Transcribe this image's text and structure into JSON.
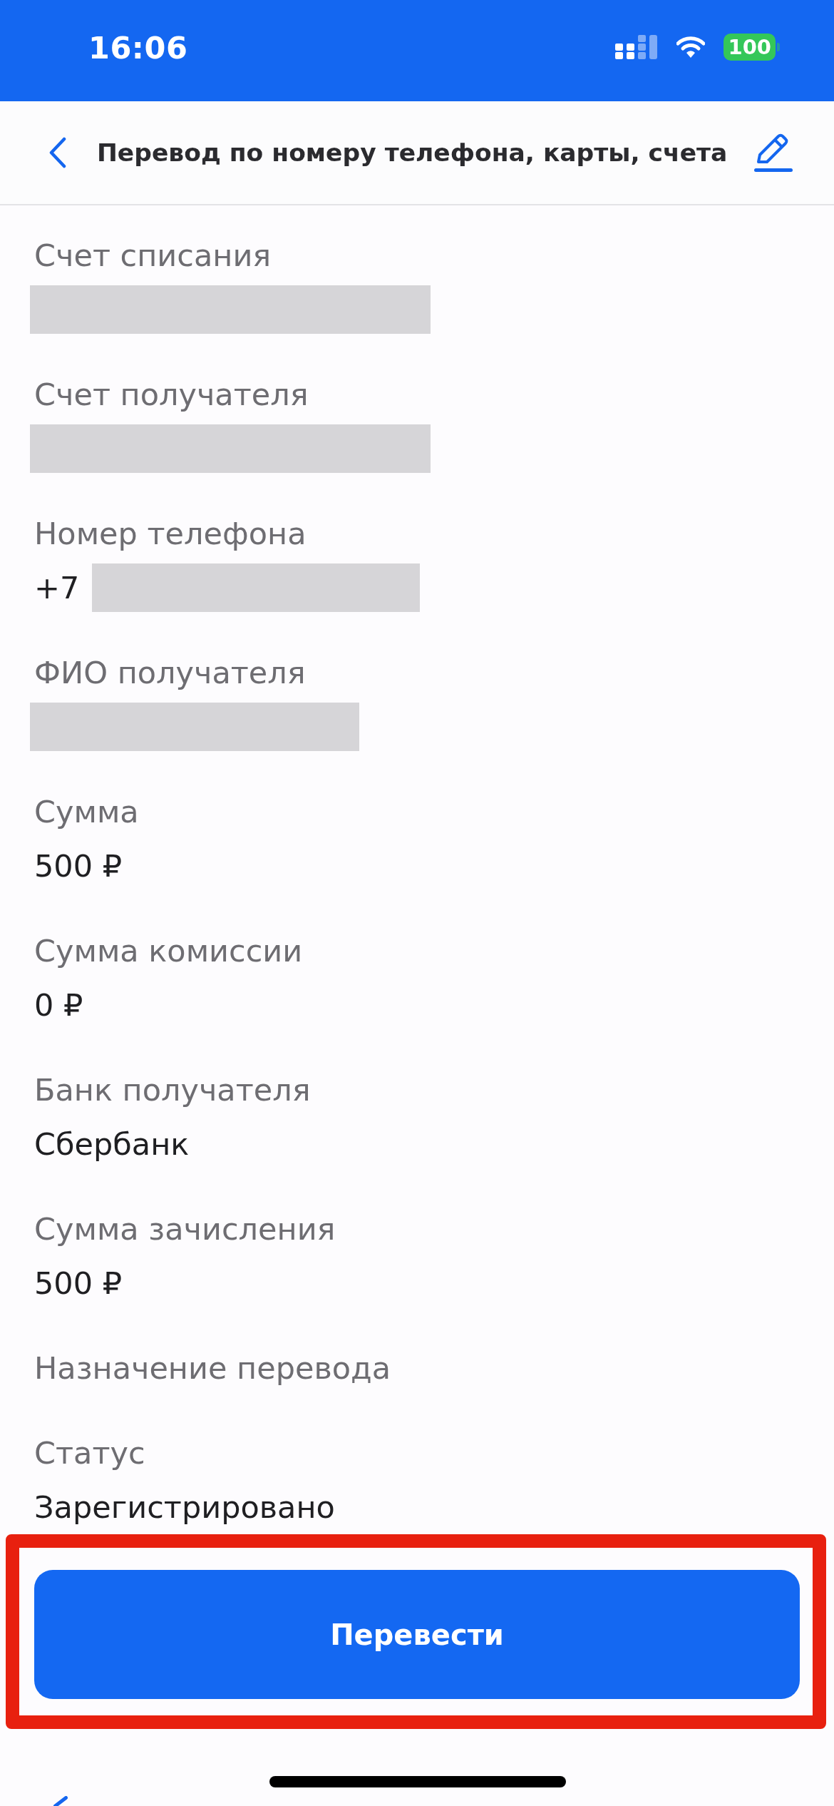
{
  "status_bar": {
    "time": "16:06",
    "battery": "100"
  },
  "header": {
    "title": "Перевод по номеру телефона, карты, счета"
  },
  "fields": [
    {
      "label": "Счет списания",
      "redacted": true
    },
    {
      "label": "Счет получателя",
      "redacted": true
    },
    {
      "label": "Номер телефона",
      "value": "+7",
      "redacted": true
    },
    {
      "label": "ФИО получателя",
      "redacted": true
    },
    {
      "label": "Сумма",
      "value": "500 ₽"
    },
    {
      "label": "Сумма комиссии",
      "value": "0 ₽"
    },
    {
      "label": "Банк получателя",
      "value": "Сбербанк"
    },
    {
      "label": "Сумма зачисления",
      "value": "500 ₽"
    },
    {
      "label": "Назначение перевода"
    },
    {
      "label": "Статус",
      "value": "Зарегистрировано"
    }
  ],
  "button": {
    "label": "Перевести",
    "highlighted": true
  }
}
